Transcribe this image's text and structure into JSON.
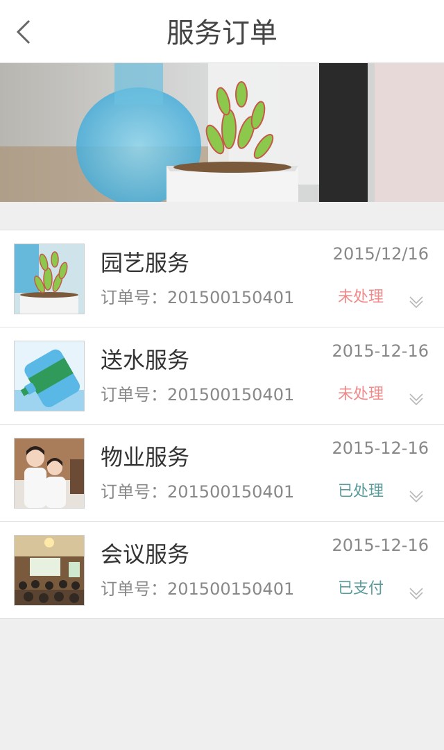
{
  "header": {
    "title": "服务订单",
    "back_icon": "chevron-left-icon"
  },
  "colors": {
    "pending": "#f08a8a",
    "done": "#5a9a9a",
    "paid": "#5a9a9a"
  },
  "orders": [
    {
      "name": "园艺服务",
      "order_label": "订单号：201500150401",
      "date": "2015/12/16",
      "status": "未处理",
      "status_type": "pending",
      "thumb": "succulent-plant-image"
    },
    {
      "name": "送水服务",
      "order_label": "订单号：201500150401",
      "date": "2015-12-16",
      "status": "未处理",
      "status_type": "pending",
      "thumb": "water-bottle-image"
    },
    {
      "name": "物业服务",
      "order_label": "订单号：201500150401",
      "date": "2015-12-16",
      "status": "已处理",
      "status_type": "done",
      "thumb": "staff-photo-image"
    },
    {
      "name": "会议服务",
      "order_label": "订单号：201500150401",
      "date": "2015-12-16",
      "status": "已支付",
      "status_type": "paid",
      "thumb": "meeting-room-image"
    }
  ]
}
